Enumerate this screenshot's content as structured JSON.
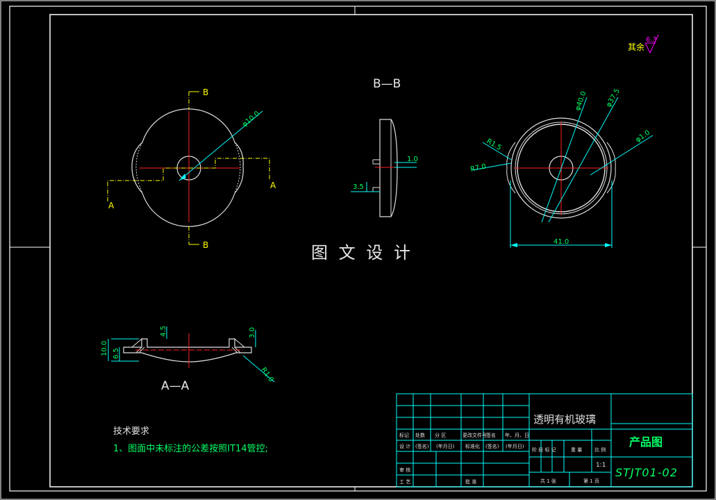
{
  "drawing": {
    "watermark": "图 文 设 计",
    "roughness_prefix": "其余",
    "roughness_value": "6.3",
    "section_bb_title": "B—B",
    "section_aa_title": "A—A",
    "cut_label_a": "A",
    "cut_label_b": "B"
  },
  "front_view": {
    "dim_hole": "φ10.0"
  },
  "side_view": {
    "dim_step": "1.0",
    "dim_boss": "3.5"
  },
  "right_view": {
    "dim_d40": "φ40.0",
    "dim_d375": "φ37.5",
    "dim_d1": "φ1.0",
    "dim_r15": "R1.5",
    "dim_r7": "R7.0",
    "dim_width": "41.0"
  },
  "section_aa": {
    "dim_45": "4.5",
    "dim_30": "3.0",
    "dim_100": "10.0",
    "dim_65": "6.5",
    "dim_r1": "R1.0"
  },
  "notes": {
    "title": "技术要求",
    "line1": "1、图面中未标注的公差按照IT14管控;"
  },
  "title_block": {
    "part_name": "透明有机玻璃",
    "drawing_type": "产品图",
    "drawing_no": "STJT01-02",
    "row_headers": [
      "标记",
      "处数",
      "分 区",
      "更改文件号",
      "签名",
      "年、月、日"
    ],
    "row_design": [
      "设 计",
      "(签名)",
      "(年月日)",
      "标准化",
      "(签名)",
      "(年月日)"
    ],
    "row_check": "审 核",
    "row_process": "工 艺",
    "approve": "批 准",
    "stage_headers": [
      "阶 段 标 记",
      "重 量",
      "比 例"
    ],
    "scale": "1:1",
    "sheets": "共 1 张",
    "sheet_no": "第 1 页"
  },
  "colors": {
    "frame": "#ffffff",
    "center_line": "#ff2020",
    "dimension": "#00ffff",
    "dim_text": "#00ff66",
    "cut_label": "#ffff00",
    "roughness": "#ff00ff"
  }
}
